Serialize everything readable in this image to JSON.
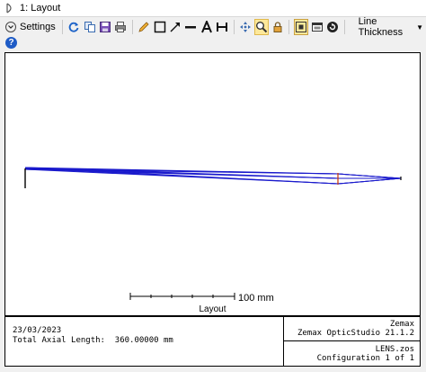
{
  "window": {
    "title": "1: Layout"
  },
  "toolbar": {
    "settings_label": "Settings",
    "line_thickness_label": "Line Thickness",
    "icons": [
      "refresh-icon",
      "copy-icon",
      "save-icon",
      "print-icon",
      "pencil-icon",
      "rectangle-icon",
      "arrow-icon",
      "line-icon",
      "text-icon",
      "dimension-icon",
      "pan-icon",
      "zoom-icon",
      "lock-icon",
      "fit-icon",
      "window-icon",
      "cycle-icon"
    ]
  },
  "help": {
    "icon": "help-icon"
  },
  "plot": {
    "scale_label": "100 mm",
    "panel_title": "Layout",
    "ray_color": "#1a1acc",
    "lens_color": "#cc3300"
  },
  "info": {
    "date": "23/03/2023",
    "total_axial_length": "Total Axial Length:  360.00000 mm",
    "company": "Zemax",
    "product": "Zemax OpticStudio 21.1.2",
    "file": "LENS.zos",
    "configuration": "Configuration 1 of 1"
  }
}
